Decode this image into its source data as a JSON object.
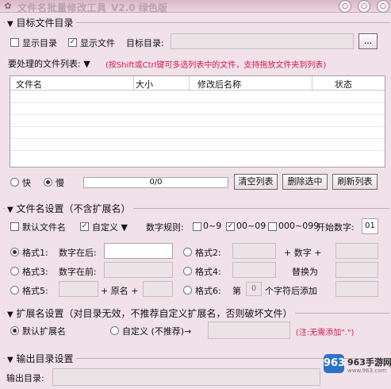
{
  "window": {
    "title": "文件名批量修改工具",
    "version": "V2.0  绿色版",
    "minimize_glyph": "○",
    "maximize_glyph": "○",
    "close_glyph": "○",
    "app_icon": "gear-icon"
  },
  "target_dir": {
    "section_title": "目标文件目录",
    "arrow": "▼",
    "show_dir_label": "显示目录",
    "show_dir_checked": false,
    "show_file_label": "显示文件",
    "show_file_checked": true,
    "target_label": "目标目录:",
    "target_value": "",
    "browse_label": "..."
  },
  "file_list": {
    "label": "要处理的文件列表: ▼",
    "hint": "(按Shift或Ctrl键可多选列表中的文件，支持拖放文件夹到列表)",
    "columns": [
      "文件名",
      "大小",
      "修改后名称",
      "状态"
    ],
    "rows": []
  },
  "actions": {
    "fast_label": "快",
    "fast_selected": false,
    "slow_label": "慢",
    "slow_selected": true,
    "progress_text": "0/0",
    "progress": 0,
    "clear_label": "清空列表",
    "delete_label": "删除选中",
    "refresh_label": "刷新列表"
  },
  "filename_settings": {
    "section_title": "文件名设置（不含扩展名）",
    "default_label": "默认文件名",
    "default_checked": false,
    "custom_label": "自定义 ▼",
    "custom_checked": true,
    "number_rule_label": "数字规则:",
    "rule1_label": "0~9",
    "rule1_checked": false,
    "rule2_label": "00~09",
    "rule2_checked": true,
    "rule3_label": "000~099",
    "rule3_checked": false,
    "start_label": "开始数字:",
    "start_value": "01",
    "format1_label": "格式1:",
    "format1_text": "数字在后:",
    "format1_value": "",
    "format2_label": "格式2:",
    "format2_plus": "+ 数字 +",
    "format3_label": "格式3:",
    "format3_text": "数字在前:",
    "format4_label": "格式4:",
    "format4_text": "替换为",
    "format5_label": "格式5:",
    "format5_plus1": "+ 原名 +",
    "format6_label": "格式6:",
    "format6_text1": "第",
    "format6_value": "0",
    "format6_text2": "个字符后添加",
    "selected_format": 1
  },
  "ext_settings": {
    "section_title": "扩展名设置（对目录无效，不推荐自定义扩展名，否则破坏文件）",
    "default_label": "默认扩展名",
    "default_selected": true,
    "custom_label": "自定义 (不推荐)→",
    "custom_selected": false,
    "note": "(注:无需添加\".\")"
  },
  "output": {
    "section_title": "输出目录设置",
    "label": "输出目录:",
    "value": ""
  },
  "watermark": {
    "badge": "963",
    "text": "963手游网",
    "sub": "www.963.com"
  },
  "colors": {
    "background": "#f1e2ea",
    "accent_red": "#d2184b",
    "watermark_blue": "#2d73c8"
  }
}
